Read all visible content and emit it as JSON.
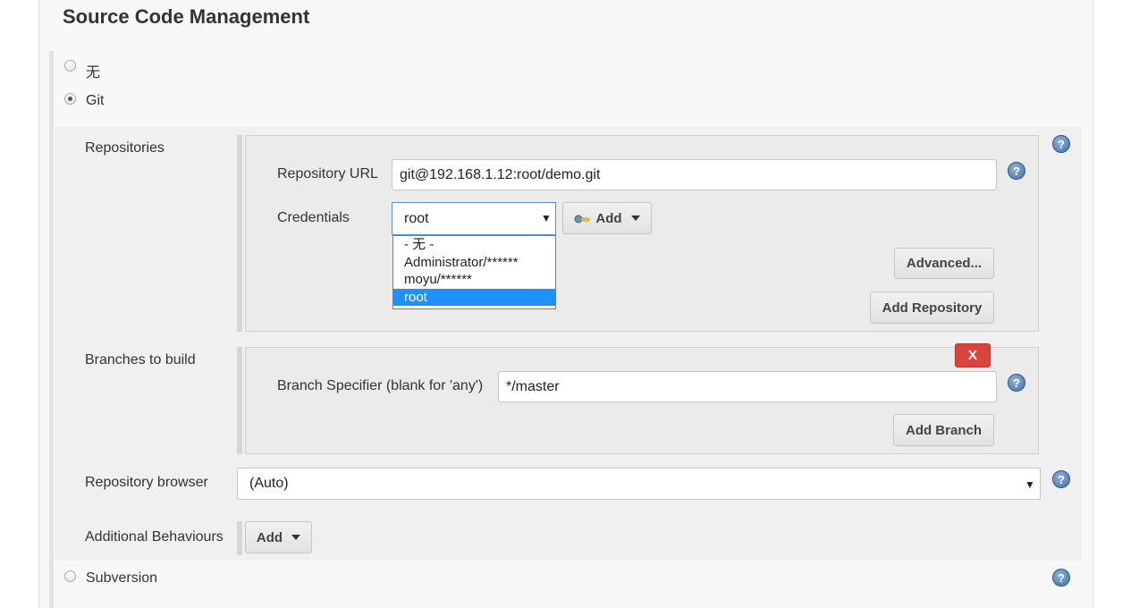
{
  "section": {
    "title": "Source Code Management"
  },
  "scm_options": {
    "none_label": "无",
    "git_label": "Git",
    "subversion_label": "Subversion",
    "selected": "Git"
  },
  "git": {
    "repositories_label": "Repositories",
    "repository_url_label": "Repository URL",
    "repository_url_value": "git@192.168.1.12:root/demo.git",
    "credentials_label": "Credentials",
    "credentials_selected": "root",
    "credentials_options": [
      "- 无 -",
      "Administrator/******",
      "moyu/******",
      "root"
    ],
    "add_credentials_label": "Add",
    "advanced_label": "Advanced...",
    "add_repository_label": "Add Repository",
    "branches_label": "Branches to build",
    "branch_specifier_label": "Branch Specifier (blank for 'any')",
    "branch_specifier_value": "*/master",
    "delete_branch_label": "X",
    "add_branch_label": "Add Branch",
    "repository_browser_label": "Repository browser",
    "repository_browser_value": "(Auto)",
    "additional_behaviours_label": "Additional Behaviours",
    "additional_behaviours_add_label": "Add"
  },
  "icons": {
    "help": "help-icon",
    "key": "key-icon",
    "caret": "caret-down-icon"
  },
  "colors": {
    "selection": "#1e90ff",
    "delete_button": "#d9453c",
    "help_icon": "#3f6fa6"
  }
}
